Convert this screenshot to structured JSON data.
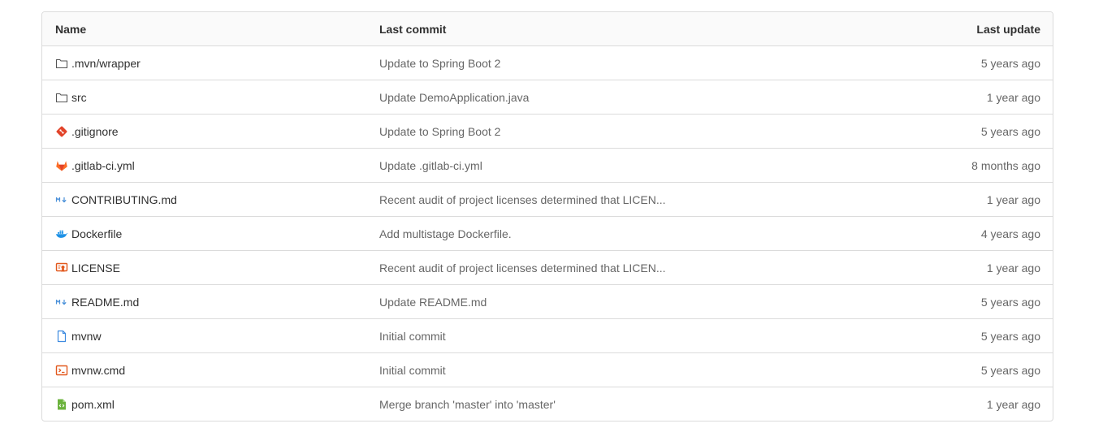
{
  "table": {
    "headers": {
      "name": "Name",
      "last_commit": "Last commit",
      "last_update": "Last update"
    },
    "rows": [
      {
        "icon": "folder-icon",
        "name": ".mvn/wrapper",
        "commit": "Update to Spring Boot 2",
        "updated": "5 years ago"
      },
      {
        "icon": "folder-icon",
        "name": "src",
        "commit": "Update DemoApplication.java",
        "updated": "1 year ago"
      },
      {
        "icon": "git-icon",
        "name": ".gitignore",
        "commit": "Update to Spring Boot 2",
        "updated": "5 years ago"
      },
      {
        "icon": "gitlab-icon",
        "name": ".gitlab-ci.yml",
        "commit": "Update .gitlab-ci.yml",
        "updated": "8 months ago"
      },
      {
        "icon": "markdown-icon",
        "name": "CONTRIBUTING.md",
        "commit": "Recent audit of project licenses determined that LICEN...",
        "updated": "1 year ago"
      },
      {
        "icon": "docker-icon",
        "name": "Dockerfile",
        "commit": "Add multistage Dockerfile.",
        "updated": "4 years ago"
      },
      {
        "icon": "license-icon",
        "name": "LICENSE",
        "commit": "Recent audit of project licenses determined that LICEN...",
        "updated": "1 year ago"
      },
      {
        "icon": "markdown-icon",
        "name": "README.md",
        "commit": "Update README.md",
        "updated": "5 years ago"
      },
      {
        "icon": "file-icon",
        "name": "mvnw",
        "commit": "Initial commit",
        "updated": "5 years ago"
      },
      {
        "icon": "terminal-icon",
        "name": "mvnw.cmd",
        "commit": "Initial commit",
        "updated": "5 years ago"
      },
      {
        "icon": "xml-file-icon",
        "name": "pom.xml",
        "commit": "Merge branch 'master' into 'master'",
        "updated": "1 year ago"
      }
    ]
  },
  "colors": {
    "border": "#dbdbdb",
    "header_bg": "#fafafa",
    "text": "#303030",
    "muted": "#666666",
    "git": "#e24329",
    "gitlab": "#fc6d26",
    "markdown": "#4a90d9",
    "docker": "#1d91e6",
    "license": "#e2591e",
    "file": "#3e8be0",
    "terminal": "#e2591e",
    "xml": "#6cb33e"
  }
}
